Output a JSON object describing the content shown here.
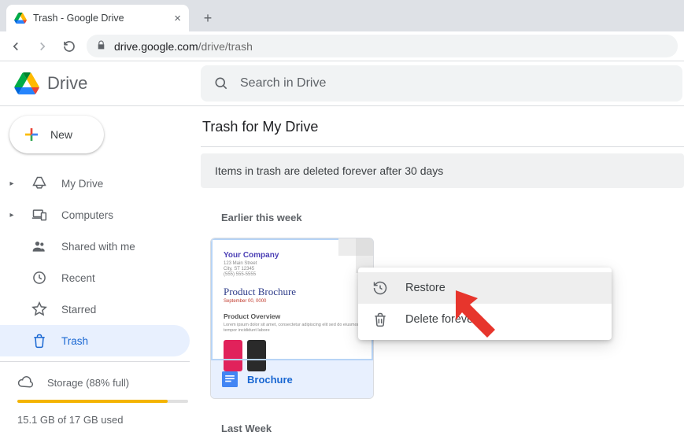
{
  "browser": {
    "tab_title": "Trash - Google Drive",
    "url_host": "drive.google.com",
    "url_path": "/drive/trash"
  },
  "app": {
    "name": "Drive",
    "search_placeholder": "Search in Drive",
    "new_button": "New"
  },
  "sidebar": {
    "items": [
      {
        "label": "My Drive",
        "has_caret": true
      },
      {
        "label": "Computers",
        "has_caret": true
      },
      {
        "label": "Shared with me",
        "has_caret": false
      },
      {
        "label": "Recent",
        "has_caret": false
      },
      {
        "label": "Starred",
        "has_caret": false
      },
      {
        "label": "Trash",
        "has_caret": false,
        "active": true
      }
    ],
    "storage_label": "Storage (88% full)",
    "storage_percent": 88,
    "storage_used": "15.1 GB of 17 GB used"
  },
  "main": {
    "title": "Trash for My Drive",
    "banner": "Items in trash are deleted forever after 30 days",
    "sections": [
      {
        "heading": "Earlier this week"
      },
      {
        "heading": "Last Week"
      }
    ],
    "file": {
      "name": "Brochure",
      "preview": {
        "company": "Your Company",
        "title": "Product Brochure",
        "overview": "Product Overview"
      }
    }
  },
  "context_menu": {
    "restore": "Restore",
    "delete": "Delete forever"
  }
}
